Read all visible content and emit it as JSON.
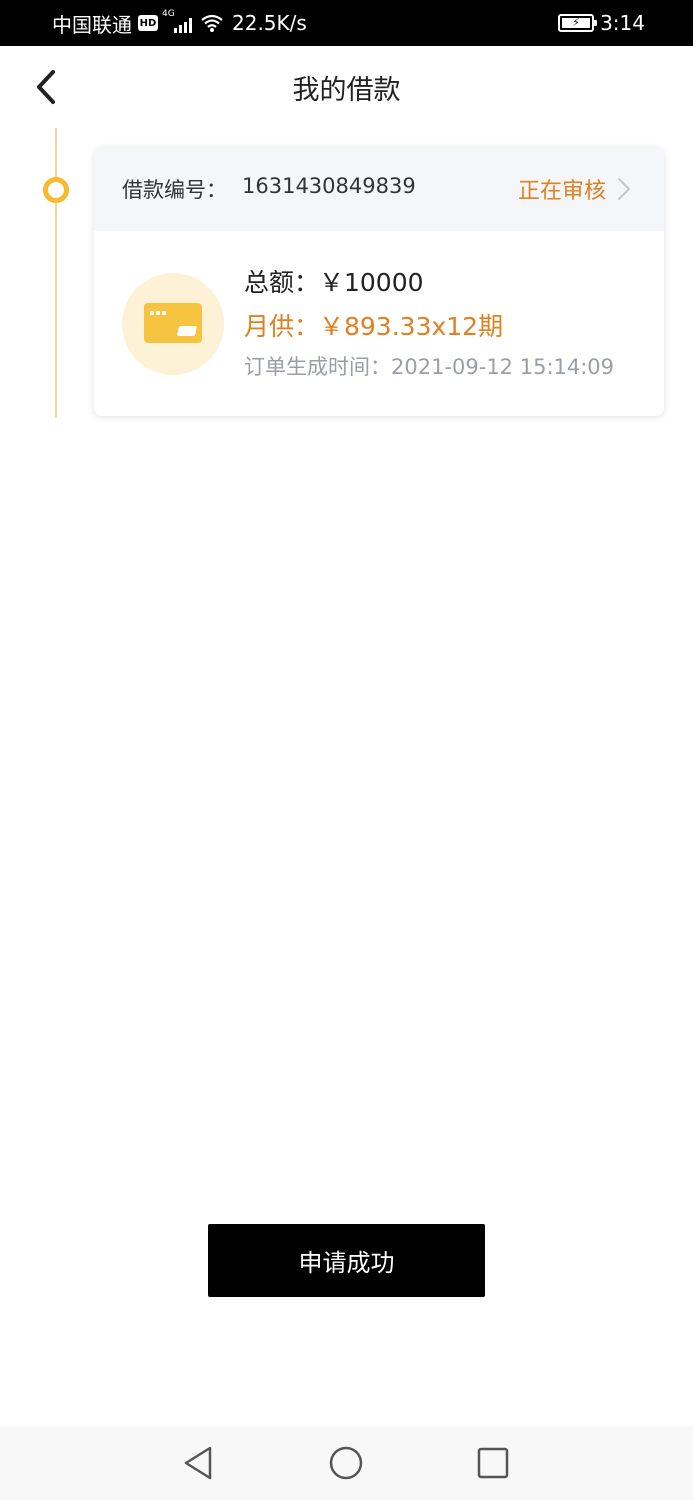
{
  "status_bar": {
    "carrier": "中国联通",
    "hd_badge": "HD",
    "network_type": "4G",
    "speed": "22.5K/s",
    "time": "3:14",
    "icons": [
      "hd-icon",
      "signal-icon",
      "wifi-icon",
      "battery-charging-icon"
    ]
  },
  "header": {
    "title": "我的借款",
    "back_icon": "chevron-left-icon"
  },
  "loan": {
    "number_label": "借款编号：",
    "number": "1631430849839",
    "status": "正在审核",
    "total": "总额：￥10000",
    "monthly": "月供：￥893.33x12期",
    "created_time": "订单生成时间：2021-09-12 15:14:09"
  },
  "apply_button": {
    "label": "申请成功"
  },
  "nav_bar": {
    "icons": [
      "nav-back-icon",
      "nav-home-icon",
      "nav-recents-icon"
    ]
  },
  "colors": {
    "accent_orange": "#e0801e",
    "timeline_dot": "#f7b92e",
    "card_icon": "#f7c441",
    "card_header_bg": "#f4f6fa",
    "button_bg": "#000000"
  }
}
